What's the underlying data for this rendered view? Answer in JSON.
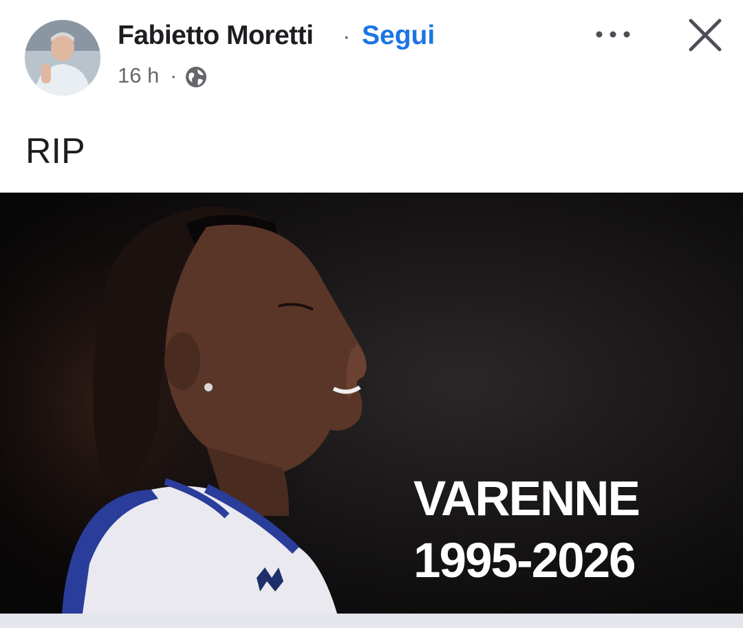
{
  "post": {
    "author": "Fabietto Moretti",
    "separator": "·",
    "follow_label": "Segui",
    "time": "16 h",
    "meta_separator": "·",
    "privacy_icon": "globe-icon",
    "more_icon": "more-options-icon",
    "close_icon": "close-icon",
    "text": "RIP"
  },
  "image": {
    "title": "VARENNE",
    "years": "1995-2026",
    "subject": "athlete portrait on dark background"
  },
  "colors": {
    "link": "#1b74e4",
    "text": "#1c1e21",
    "meta": "#65676b",
    "image_background": "#0c0b0c"
  }
}
